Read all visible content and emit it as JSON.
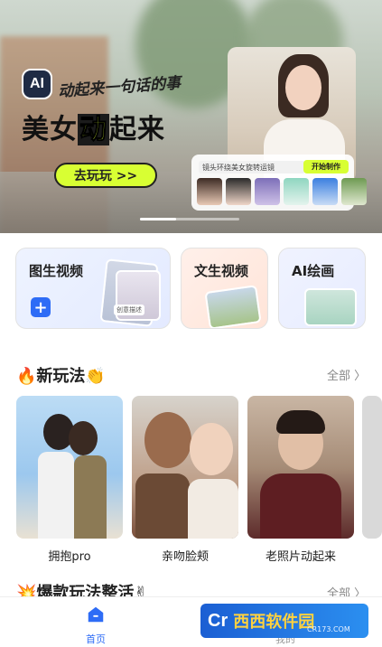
{
  "banner": {
    "ai_badge": "AI",
    "slogan": "动起来一句话的事",
    "headline_prefix": "美女",
    "headline_highlight": "动",
    "headline_suffix": "起来",
    "cta": "去玩玩 >>",
    "prompt_text": "镜头环绕美女旋转运镜",
    "make_button": "开始制作"
  },
  "features": [
    {
      "label": "图生视频",
      "tag": "创意描述"
    },
    {
      "label": "文生视频"
    },
    {
      "label": "AI绘画"
    }
  ],
  "section_new": {
    "title": "🔥新玩法👏",
    "more": "全部 〉",
    "items": [
      {
        "label": "拥抱pro"
      },
      {
        "label": "亲吻脸颊"
      },
      {
        "label": "老照片动起来"
      }
    ]
  },
  "section_hot": {
    "title": "💥爆款玩法整活✌",
    "more": "全部 〉"
  },
  "tabbar": {
    "home": "首页",
    "me": "我的"
  },
  "watermark": {
    "logo": "Cr",
    "name": "西西软件园",
    "url": "CR173.COM"
  },
  "colors": {
    "accent": "#2e6cf6",
    "lime": "#d8ff33"
  }
}
